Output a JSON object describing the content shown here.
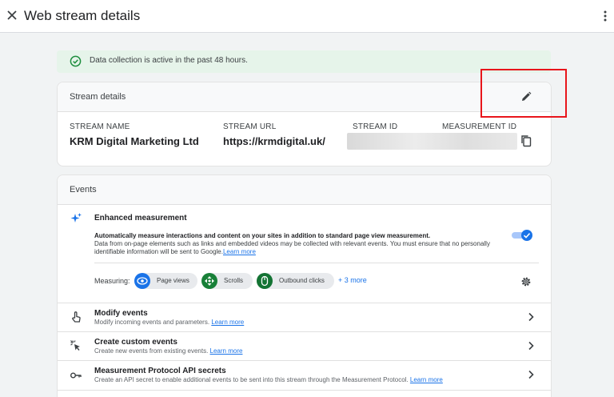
{
  "header": {
    "title": "Web stream details",
    "close_icon": "close-icon",
    "menu_icon": "more-vert-icon"
  },
  "banner": {
    "text": "Data collection is active in the past 48 hours.",
    "icon": "check-circle-icon",
    "color": "#1e8e3e"
  },
  "stream_details": {
    "title": "Stream details",
    "edit_icon": "pencil-icon",
    "fields": [
      {
        "label": "STREAM NAME",
        "value": "KRM Digital Marketing Ltd"
      },
      {
        "label": "STREAM URL",
        "value": "https://krmdigital.uk/"
      },
      {
        "label": "STREAM ID",
        "value": ""
      },
      {
        "label": "MEASUREMENT ID",
        "value": ""
      }
    ],
    "copy_icon": "copy-icon"
  },
  "events": {
    "title": "Events",
    "enhanced": {
      "title": "Enhanced measurement",
      "desc_bold": "Automatically measure interactions and content on your sites in addition to standard page view measurement.",
      "desc": "Data from on-page elements such as links and embedded videos may be collected with relevant events. You must ensure that no personally identifiable information will be sent to Google.",
      "link": "Learn more",
      "enabled": true,
      "measuring_label": "Measuring:",
      "chips": [
        {
          "label": "Page views",
          "icon": "eye-icon",
          "color": "#1a73e8"
        },
        {
          "label": "Scrolls",
          "icon": "scroll-icon",
          "color": "#188038"
        },
        {
          "label": "Outbound clicks",
          "icon": "mouse-icon",
          "color": "#137333"
        }
      ],
      "more": "+ 3 more"
    },
    "rows": [
      {
        "title": "Modify events",
        "desc": "Modify incoming events and parameters.",
        "link": "Learn more",
        "icon": "touch-icon"
      },
      {
        "title": "Create custom events",
        "desc": "Create new events from existing events.",
        "link": "Learn more",
        "icon": "cursor-click-icon"
      },
      {
        "title": "Measurement Protocol API secrets",
        "desc": "Create an API secret to enable additional events to be sent into this stream through the Measurement Protocol.",
        "link": "Learn more",
        "icon": "key-icon"
      }
    ]
  },
  "colors": {
    "accent": "#1a73e8",
    "highlight": "#e8151b",
    "banner_bg": "#e6f4ea"
  }
}
